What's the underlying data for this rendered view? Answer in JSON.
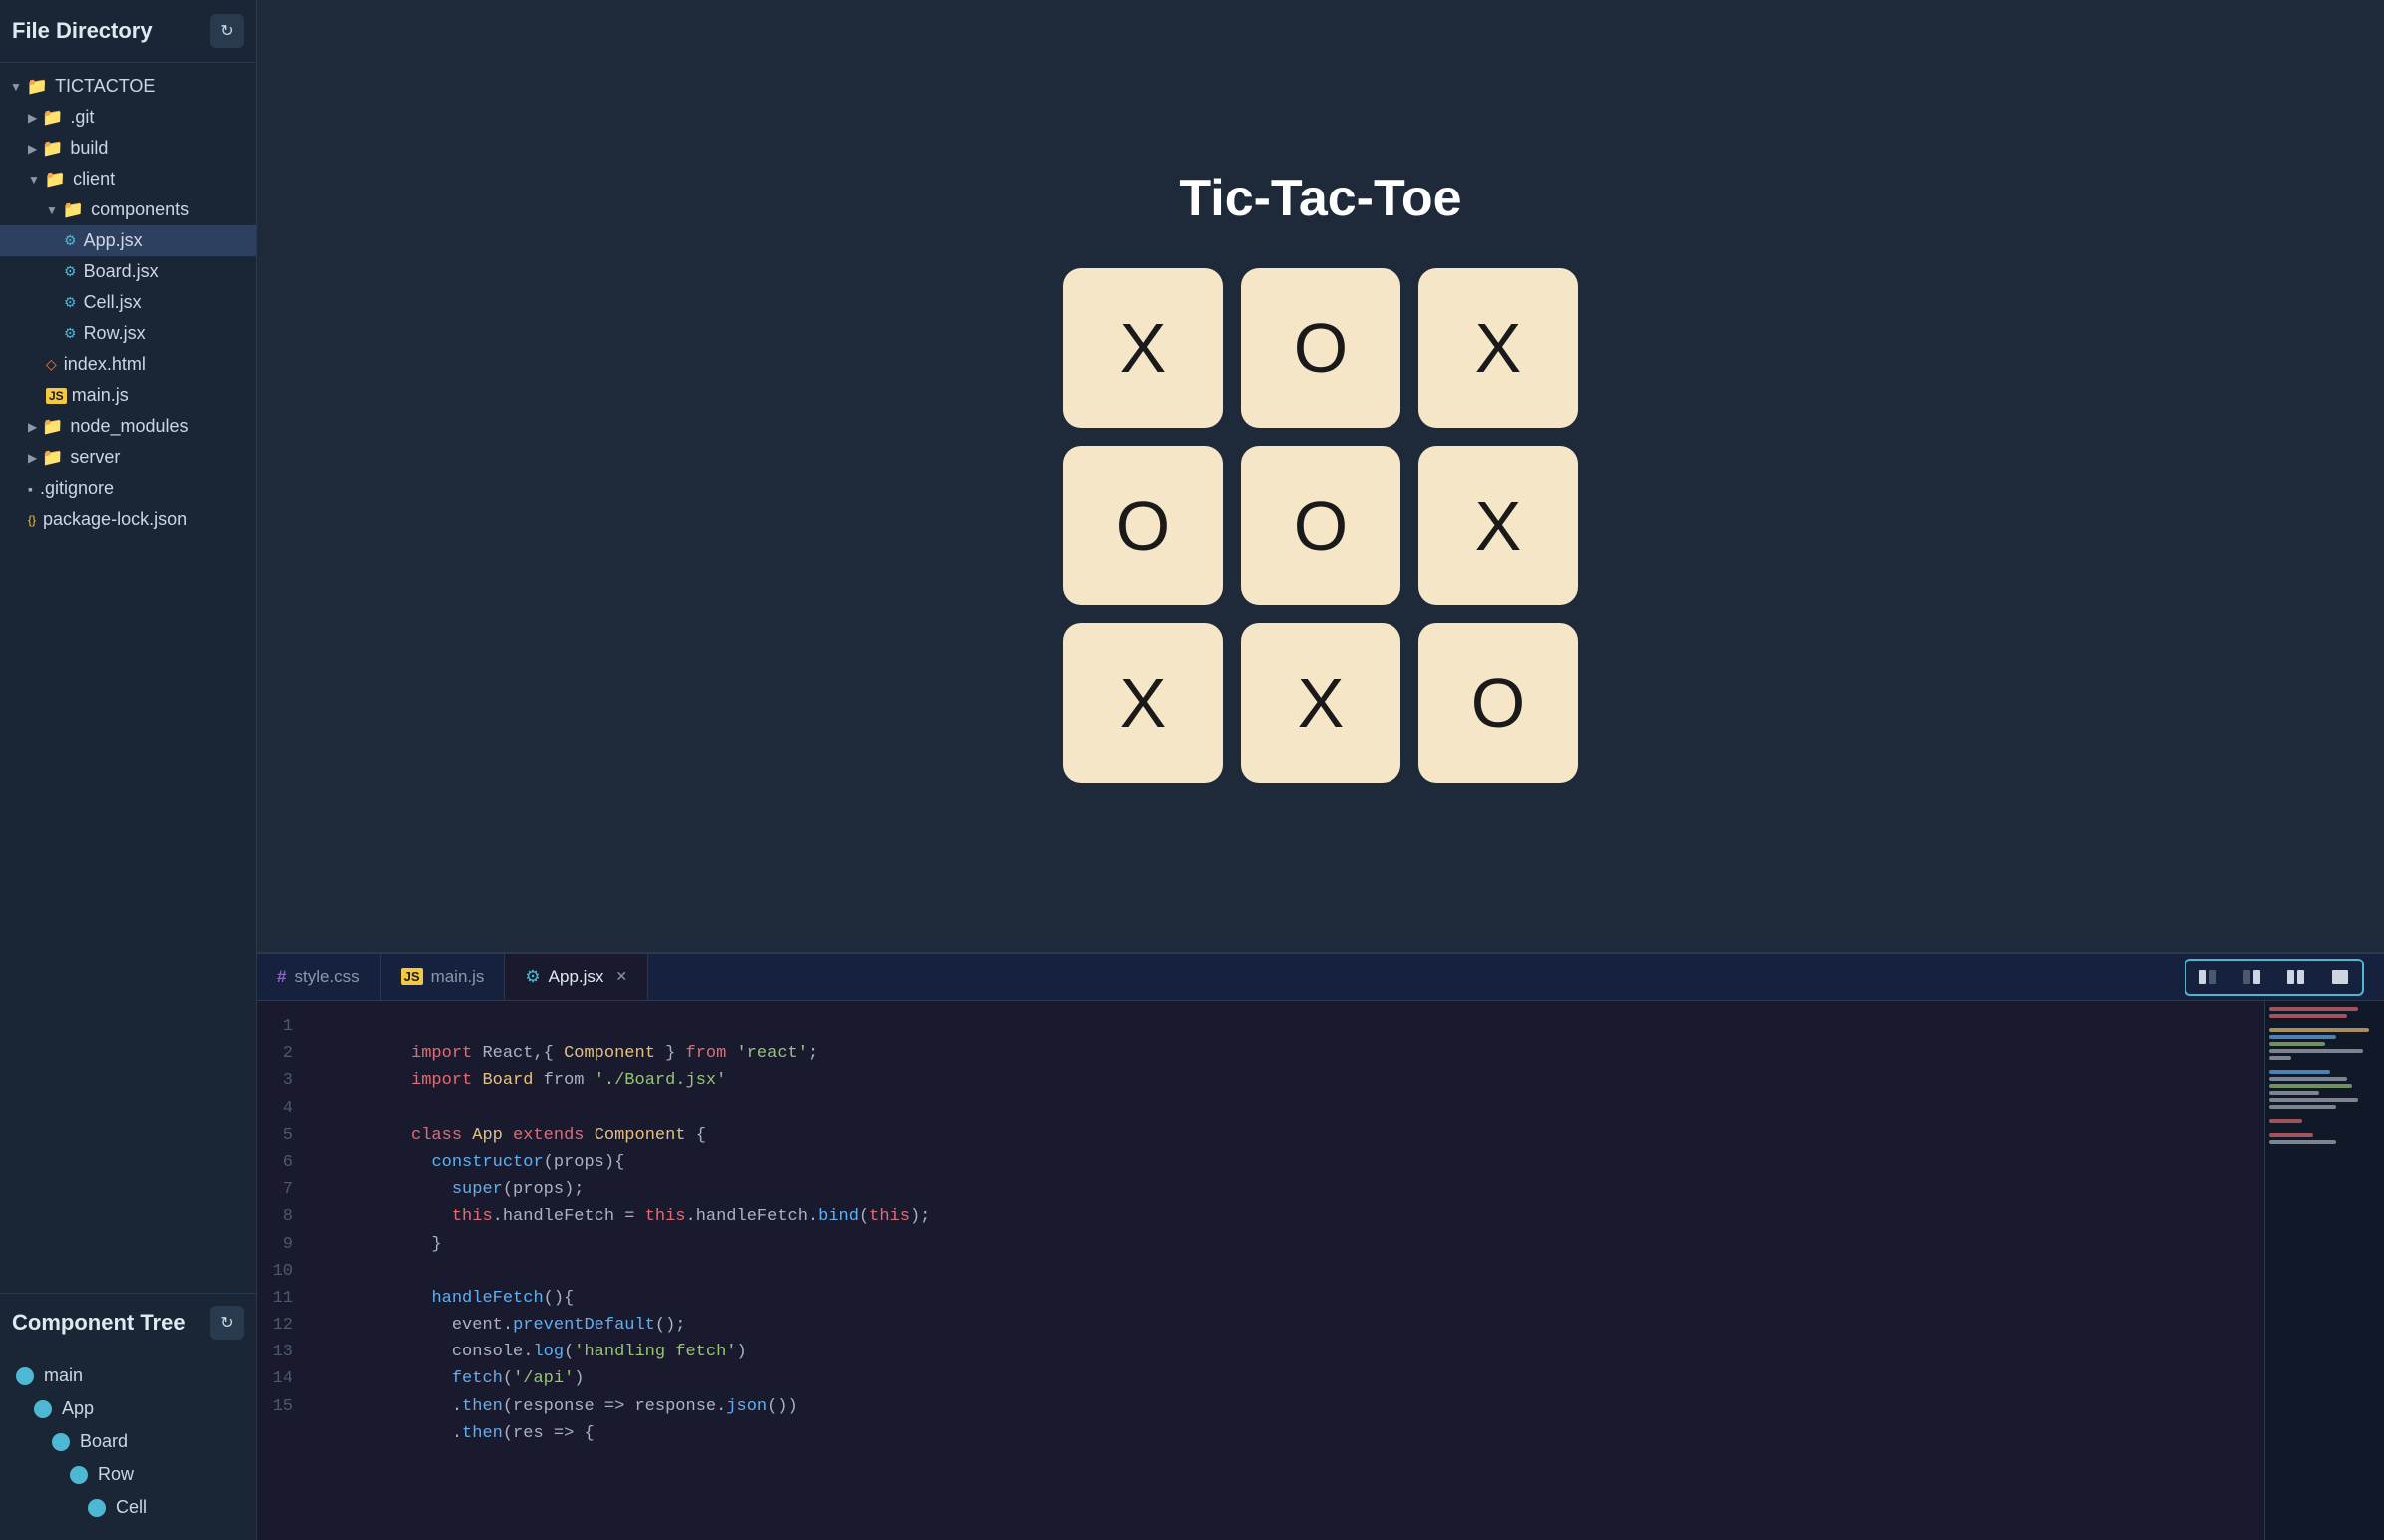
{
  "sidebar": {
    "title": "File Directory",
    "refresh_label": "↻",
    "tree": [
      {
        "id": "tictactoe",
        "label": "TICTACTOE",
        "type": "folder-open",
        "indent": 0,
        "chevron": "▼"
      },
      {
        "id": "git",
        "label": ".git",
        "type": "folder",
        "indent": 1,
        "chevron": "▶"
      },
      {
        "id": "build",
        "label": "build",
        "type": "folder",
        "indent": 1,
        "chevron": "▶"
      },
      {
        "id": "client",
        "label": "client",
        "type": "folder-open",
        "indent": 1,
        "chevron": "▼"
      },
      {
        "id": "components",
        "label": "components",
        "type": "folder-open",
        "indent": 2,
        "chevron": "▼"
      },
      {
        "id": "app-jsx",
        "label": "App.jsx",
        "type": "file-jsx",
        "indent": 3,
        "active": true
      },
      {
        "id": "board-jsx",
        "label": "Board.jsx",
        "type": "file-jsx",
        "indent": 3
      },
      {
        "id": "cell-jsx",
        "label": "Cell.jsx",
        "type": "file-jsx",
        "indent": 3
      },
      {
        "id": "row-jsx",
        "label": "Row.jsx",
        "type": "file-jsx",
        "indent": 3
      },
      {
        "id": "index-html",
        "label": "index.html",
        "type": "file-html",
        "indent": 2
      },
      {
        "id": "main-js",
        "label": "main.js",
        "type": "file-js",
        "indent": 2
      },
      {
        "id": "node_modules",
        "label": "node_modules",
        "type": "folder",
        "indent": 1,
        "chevron": "▶"
      },
      {
        "id": "server",
        "label": "server",
        "type": "folder",
        "indent": 1,
        "chevron": "▶"
      },
      {
        "id": "gitignore",
        "label": ".gitignore",
        "type": "file-git",
        "indent": 1
      },
      {
        "id": "package-lock",
        "label": "package-lock.json",
        "type": "file-json",
        "indent": 1
      }
    ]
  },
  "component_tree": {
    "title": "Component Tree",
    "refresh_label": "↻",
    "nodes": [
      {
        "id": "main",
        "label": "main",
        "color": "#4db8d4",
        "indent": 0
      },
      {
        "id": "app",
        "label": "App",
        "color": "#4db8d4",
        "indent": 1
      },
      {
        "id": "board",
        "label": "Board",
        "color": "#4db8d4",
        "indent": 2
      },
      {
        "id": "row",
        "label": "Row",
        "color": "#4db8d4",
        "indent": 3
      },
      {
        "id": "cell",
        "label": "Cell",
        "color": "#4db8d4",
        "indent": 4
      }
    ]
  },
  "preview": {
    "title": "Tic-Tac-Toe",
    "board": [
      [
        "X",
        "O",
        "X"
      ],
      [
        "O",
        "O",
        "X"
      ],
      [
        "X",
        "X",
        "O"
      ]
    ]
  },
  "editor": {
    "tabs": [
      {
        "id": "style-css",
        "label": "style.css",
        "type": "css",
        "active": false
      },
      {
        "id": "main-js",
        "label": "main.js",
        "type": "js",
        "active": false
      },
      {
        "id": "app-jsx",
        "label": "App.jsx",
        "type": "jsx",
        "active": true,
        "closable": true
      }
    ],
    "view_buttons": [
      {
        "id": "split-left",
        "icon": "▐▌",
        "active": false
      },
      {
        "id": "split-right",
        "icon": "▌▐",
        "active": false
      },
      {
        "id": "split-both",
        "icon": "▐▐",
        "active": false
      },
      {
        "id": "single",
        "icon": "▬",
        "active": false
      }
    ],
    "lines": [
      {
        "num": 1,
        "code": "import React,{ Component } from 'react';"
      },
      {
        "num": 2,
        "code": "import Board from './Board.jsx'"
      },
      {
        "num": 3,
        "code": ""
      },
      {
        "num": 4,
        "code": "class App extends Component {"
      },
      {
        "num": 5,
        "code": "  constructor(props){"
      },
      {
        "num": 6,
        "code": "    super(props);"
      },
      {
        "num": 7,
        "code": "    this.handleFetch = this.handleFetch.bind(this);"
      },
      {
        "num": 8,
        "code": "  }"
      },
      {
        "num": 9,
        "code": ""
      },
      {
        "num": 10,
        "code": "  handleFetch(){"
      },
      {
        "num": 11,
        "code": "    event.preventDefault();"
      },
      {
        "num": 12,
        "code": "    console.log('handling fetch')"
      },
      {
        "num": 13,
        "code": "    fetch('/api')"
      },
      {
        "num": 14,
        "code": "    .then(response => response.json())"
      },
      {
        "num": 15,
        "code": "    .then(res => {"
      }
    ]
  },
  "colors": {
    "accent": "#4db8d4",
    "bg_dark": "#1a1a2e",
    "bg_sidebar": "#1a2535",
    "folder": "#4db8d4",
    "cell_bg": "#f5e6c8"
  }
}
